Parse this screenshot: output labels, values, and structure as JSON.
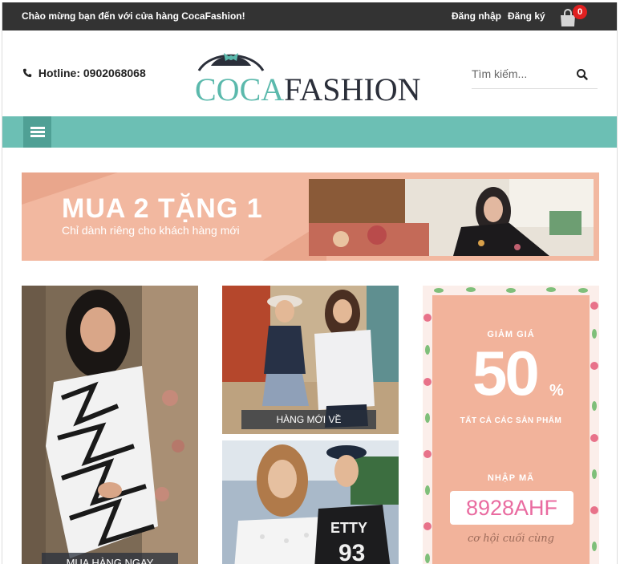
{
  "topbar": {
    "welcome": "Chào mừng bạn đến với cửa hàng CocaFashion!",
    "login": "Đăng nhập",
    "register": "Đăng ký",
    "cart_count": "0"
  },
  "header": {
    "hotline_label": "Hotline: 0902068068",
    "logo_coca": "COCA",
    "logo_fashion": "FASHION",
    "search_placeholder": "Tìm kiếm..."
  },
  "banner": {
    "headline": "MUA 2 TẶNG 1",
    "subline": "Chỉ dành riêng cho khách hàng mới"
  },
  "tiles": {
    "shop_now": "MUA HÀNG NGAY",
    "new_arrivals": "HÀNG MỚI VỀ"
  },
  "coupon": {
    "discount_label": "GIẢM GIÁ",
    "percent": "50",
    "percent_sign": "%",
    "all_products": "TẤT CẢ CÁC SẢN PHẨM",
    "enter_code": "NHẬP MÃ",
    "code": "8928AHF",
    "last_chance": "cơ hội cuối cùng"
  },
  "colors": {
    "topbar": "#333333",
    "nav": "#6cbfb4",
    "menu_button": "#4fa095",
    "brand_teal": "#5bb9ac",
    "banner_pink": "#f2b8a0",
    "coupon_pink": "#f2b39b",
    "cart_badge": "#e02020",
    "code_text": "#e96ba0"
  },
  "icons": {
    "phone": "phone-icon",
    "search": "search-icon",
    "cart": "shopping-bag-icon",
    "menu": "hamburger-icon",
    "logo": "hat-bow-icon"
  }
}
